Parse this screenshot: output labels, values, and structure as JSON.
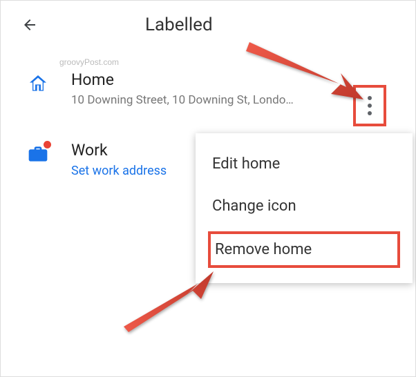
{
  "header": {
    "title": "Labelled"
  },
  "watermark": "groovyPost.com",
  "items": [
    {
      "title": "Home",
      "subtitle": "10 Downing Street, 10 Downing St, Londo…"
    },
    {
      "title": "Work",
      "link": "Set work address"
    }
  ],
  "menu": {
    "items": [
      {
        "label": "Edit home"
      },
      {
        "label": "Change icon"
      },
      {
        "label": "Remove home"
      }
    ]
  },
  "icons": {
    "home_color": "#1a73e8",
    "work_color": "#1a73e8"
  },
  "annotation": {
    "highlight_color": "#e74c3c",
    "arrow_color": "#d93025"
  }
}
